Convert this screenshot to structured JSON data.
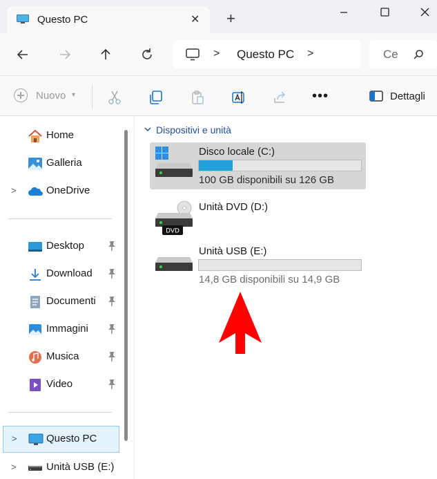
{
  "window": {
    "tab_title": "Questo PC",
    "tab_close_icon": "close-icon",
    "new_tab_icon": "plus-icon",
    "minimize_icon": "minimize-icon",
    "maximize_icon": "maximize-icon",
    "close_icon": "close-icon"
  },
  "nav": {
    "address": {
      "segment": "Questo PC",
      "icon": "computer-icon"
    },
    "search_placeholder": "Ce"
  },
  "commands": {
    "new_label": "Nuovo",
    "more_label": "•••",
    "details_label": "Dettagli"
  },
  "sidebar": {
    "items": [
      {
        "label": "Home",
        "icon": "home-icon",
        "expandable": false,
        "pinned": false
      },
      {
        "label": "Galleria",
        "icon": "gallery-icon",
        "expandable": false,
        "pinned": false
      },
      {
        "label": "OneDrive",
        "icon": "cloud-icon",
        "expandable": true,
        "pinned": false
      },
      {
        "label": "Desktop",
        "icon": "desktop-icon",
        "expandable": false,
        "pinned": true
      },
      {
        "label": "Download",
        "icon": "download-icon",
        "expandable": false,
        "pinned": true
      },
      {
        "label": "Documenti",
        "icon": "document-icon",
        "expandable": false,
        "pinned": true
      },
      {
        "label": "Immagini",
        "icon": "pictures-icon",
        "expandable": false,
        "pinned": true
      },
      {
        "label": "Musica",
        "icon": "music-icon",
        "expandable": false,
        "pinned": true
      },
      {
        "label": "Video",
        "icon": "video-icon",
        "expandable": false,
        "pinned": true
      },
      {
        "label": "Questo PC",
        "icon": "computer-icon",
        "expandable": true,
        "pinned": false,
        "selected": true
      },
      {
        "label": "Unità USB (E:)",
        "icon": "usb-drive-icon",
        "expandable": true,
        "pinned": false
      }
    ]
  },
  "main": {
    "group_title": "Dispositivi e unità",
    "drives": [
      {
        "name": "Disco locale (C:)",
        "info": "100 GB disponibili su 126 GB",
        "used_fraction": 0.21,
        "icon": "windows-drive-icon",
        "selected": true
      },
      {
        "name": "Unità DVD (D:)",
        "info": "",
        "icon": "dvd-drive-icon",
        "dvd_label": "DVD",
        "selected": false
      },
      {
        "name": "Unità USB (E:)",
        "info": "14,8 GB disponibili su 14,9 GB",
        "used_fraction": 0.0,
        "icon": "usb-drive-icon",
        "selected": false
      }
    ]
  },
  "colors": {
    "accent": "#26a0da",
    "selection": "#e5f3ff",
    "arrow": "#ff0000"
  }
}
